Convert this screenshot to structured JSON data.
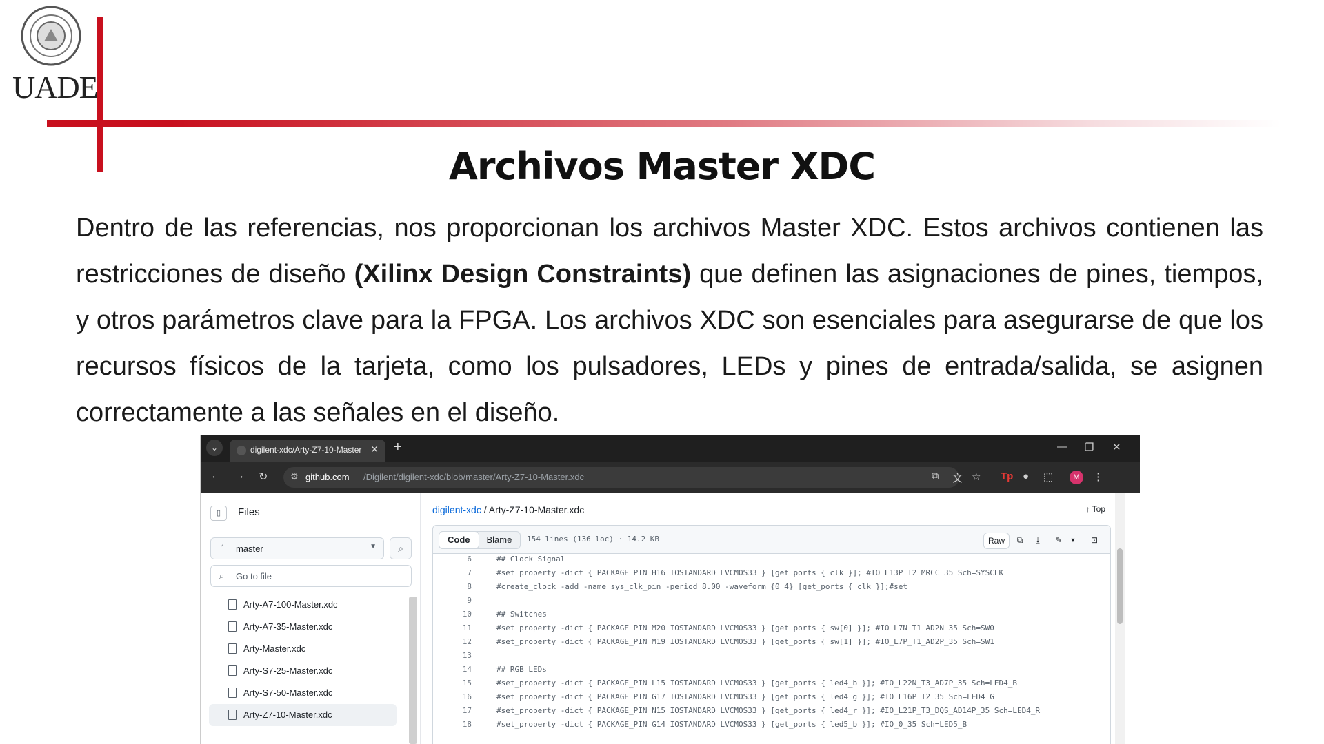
{
  "slide": {
    "logo_text": "UADE",
    "title": "Archivos Master XDC",
    "paragraph_part1": "Dentro de las referencias, nos proporcionan los archivos Master XDC. Estos archivos contienen las restricciones de diseño ",
    "paragraph_bold": "(Xilinx Design Constraints)",
    "paragraph_part2": " que definen las asignaciones de pines, tiempos, y otros parámetros clave para la FPGA. Los archivos XDC son esenciales para asegurarse de que los recursos físicos de la tarjeta, como los pulsadores, LEDs y pines de entrada/salida, se asignen correctamente a las señales en el diseño.",
    "accent_color": "#c8101e"
  },
  "browser": {
    "tab_title": "digilent-xdc/Arty-Z7-10-Master",
    "url_host": "github.com",
    "url_path": "/Digilent/digilent-xdc/blob/master/Arty-Z7-10-Master.xdc",
    "sidebar": {
      "title": "Files",
      "branch": "master",
      "goto_placeholder": "Go to file",
      "files": [
        "Arty-A7-100-Master.xdc",
        "Arty-A7-35-Master.xdc",
        "Arty-Master.xdc",
        "Arty-S7-25-Master.xdc",
        "Arty-S7-50-Master.xdc",
        "Arty-Z7-10-Master.xdc"
      ],
      "active_file": "Arty-Z7-10-Master.xdc"
    },
    "main": {
      "repo_link": "digilent-xdc",
      "filename": "Arty-Z7-10-Master.xdc",
      "top_label": "Top",
      "tab_code": "Code",
      "tab_blame": "Blame",
      "meta": "154 lines (136 loc) · 14.2 KB",
      "raw_label": "Raw",
      "code_lines": [
        {
          "n": "6",
          "t": "## Clock Signal"
        },
        {
          "n": "7",
          "t": "#set_property -dict { PACKAGE_PIN H16    IOSTANDARD LVCMOS33 } [get_ports { clk }]; #IO_L13P_T2_MRCC_35 Sch=SYSCLK"
        },
        {
          "n": "8",
          "t": "#create_clock -add -name sys_clk_pin -period 8.00 -waveform {0 4} [get_ports { clk }];#set"
        },
        {
          "n": "9",
          "t": ""
        },
        {
          "n": "10",
          "t": "## Switches"
        },
        {
          "n": "11",
          "t": "#set_property -dict { PACKAGE_PIN M20  IOSTANDARD LVCMOS33 } [get_ports { sw[0] }]; #IO_L7N_T1_AD2N_35 Sch=SW0"
        },
        {
          "n": "12",
          "t": "#set_property -dict { PACKAGE_PIN M19  IOSTANDARD LVCMOS33 } [get_ports { sw[1] }]; #IO_L7P_T1_AD2P_35 Sch=SW1"
        },
        {
          "n": "13",
          "t": ""
        },
        {
          "n": "14",
          "t": "## RGB LEDs"
        },
        {
          "n": "15",
          "t": "#set_property -dict { PACKAGE_PIN L15    IOSTANDARD LVCMOS33 } [get_ports { led4_b }]; #IO_L22N_T3_AD7P_35 Sch=LED4_B"
        },
        {
          "n": "16",
          "t": "#set_property -dict { PACKAGE_PIN G17    IOSTANDARD LVCMOS33 } [get_ports { led4_g }]; #IO_L16P_T2_35 Sch=LED4_G"
        },
        {
          "n": "17",
          "t": "#set_property -dict { PACKAGE_PIN N15    IOSTANDARD LVCMOS33 } [get_ports { led4_r }]; #IO_L21P_T3_DQS_AD14P_35 Sch=LED4_R"
        },
        {
          "n": "18",
          "t": "#set_property -dict { PACKAGE_PIN G14    IOSTANDARD LVCMOS33 } [get_ports { led5_b }]; #IO_0_35 Sch=LED5_B"
        }
      ]
    }
  }
}
